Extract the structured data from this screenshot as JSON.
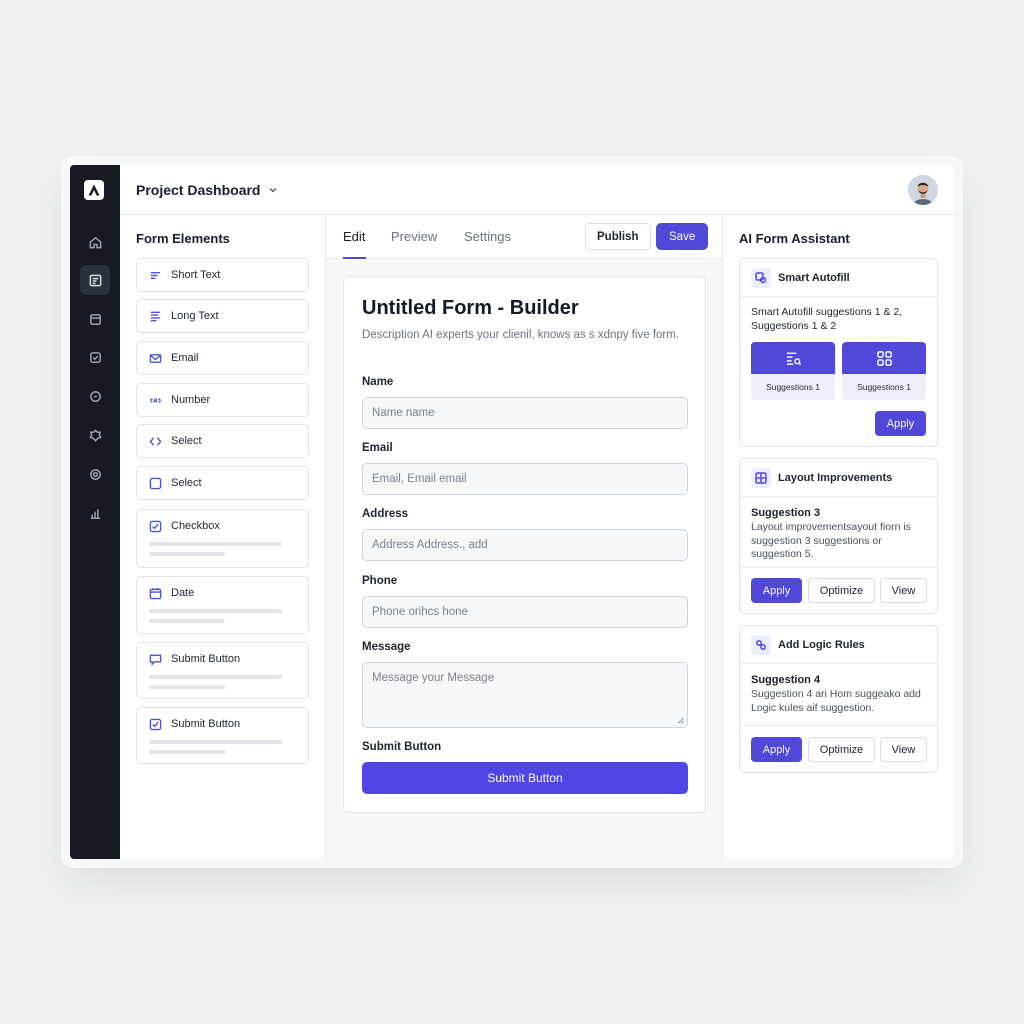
{
  "header": {
    "project_title": "Project Dashboard"
  },
  "rail": {
    "items": [
      "home-icon",
      "form-icon",
      "calendar-icon",
      "inbox-icon",
      "badge-icon",
      "settings-icon",
      "gear-icon",
      "chart-icon"
    ],
    "active_index": 1
  },
  "elements_panel": {
    "title": "Form Elements",
    "items": [
      {
        "label": "Short Text",
        "icon": "short-text-icon"
      },
      {
        "label": "Long Text",
        "icon": "long-text-icon"
      },
      {
        "label": "Email",
        "icon": "mail-icon"
      },
      {
        "label": "Number",
        "icon": "number-icon"
      },
      {
        "label": "Select",
        "icon": "code-icon"
      },
      {
        "label": "Select",
        "icon": "square-icon"
      },
      {
        "label": "Checkbox",
        "icon": "checkbox-icon"
      },
      {
        "label": "Date",
        "icon": "calendar-icon"
      },
      {
        "label": "Submit Button",
        "icon": "message-icon"
      },
      {
        "label": "Submit Button",
        "icon": "checkbox-icon"
      }
    ]
  },
  "editor": {
    "tabs": [
      "Edit",
      "Preview",
      "Settings"
    ],
    "active_tab": "Edit",
    "publish_label": "Publish",
    "save_label": "Save",
    "form": {
      "title": "Untitled Form - Builder",
      "description": "Description AI experts your clienil, knows as s xdnpy five form.",
      "fields": [
        {
          "label": "Name",
          "placeholder": "Name name"
        },
        {
          "label": "Email",
          "placeholder": "Email, Email email"
        },
        {
          "label": "Address",
          "placeholder": "Address Address., add"
        },
        {
          "label": "Phone",
          "placeholder": "Phone orihcs hone"
        },
        {
          "label": "Message",
          "placeholder": "Message your Message"
        }
      ],
      "submit_label": "Submit Button",
      "submit_button": "Submit Button"
    }
  },
  "assistant": {
    "title": "AI Form Assistant",
    "cards": [
      {
        "title": "Smart Autofill",
        "text": "Smart Autofill suggestions 1 & 2, Suggestions 1 & 2",
        "tiles": [
          "Suggestions 1",
          "Suggestions 1"
        ],
        "apply": "Apply"
      },
      {
        "title": "Layout Improvements",
        "heading": "Suggestion 3",
        "text": "Layout improvementsayout fiorn is suggestion 3 suggestions or suggestion 5.",
        "apply": "Apply",
        "optimize": "Optimize",
        "view": "View"
      },
      {
        "title": "Add Logic Rules",
        "heading": "Suggestion 4",
        "text": "Suggestion 4 ari Hom suggeako add Logic kules aif suggestion.",
        "apply": "Apply",
        "optimize": "Optimize",
        "view": "View"
      }
    ]
  },
  "colors": {
    "accent": "#4f46e5",
    "rail": "#161a22",
    "background": "#eef0f4"
  }
}
